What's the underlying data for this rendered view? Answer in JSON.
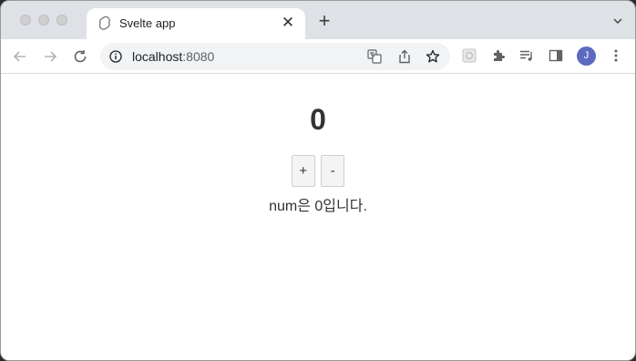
{
  "browser": {
    "tab_title": "Svelte app",
    "tab_close_glyph": "✕",
    "new_tab_glyph": "+",
    "url_host": "localhost",
    "url_port": ":8080",
    "avatar_letter": "J"
  },
  "app": {
    "count": "0",
    "increment_label": "+",
    "decrement_label": "-",
    "message": "num은 0입니다."
  }
}
